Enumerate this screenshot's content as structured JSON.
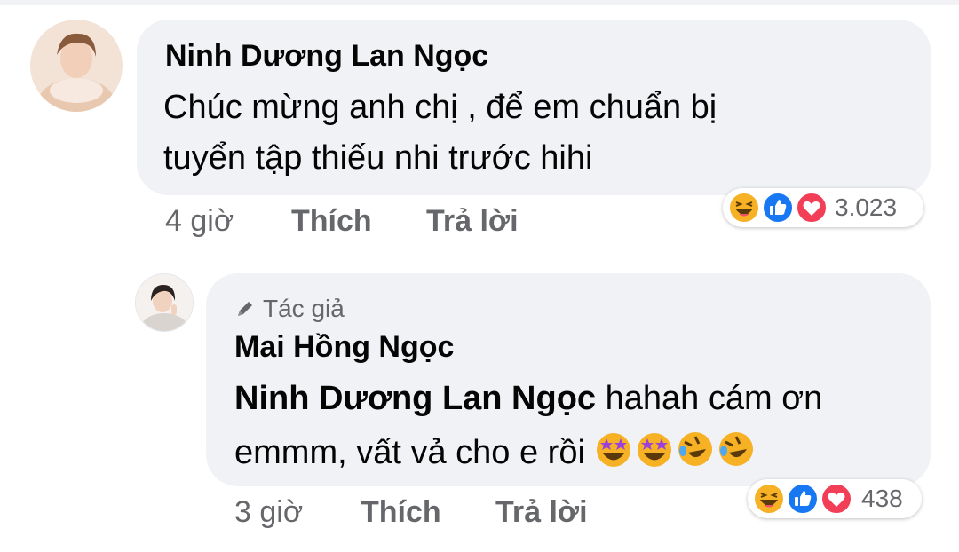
{
  "comment1": {
    "author": "Ninh Dương Lan Ngọc",
    "lines": [
      "Chúc mừng anh chị , để em chuẩn bị",
      "tuyển tập thiếu nhi trước hihi"
    ],
    "time": "4 giờ",
    "like_label": "Thích",
    "reply_label": "Trả lời",
    "reactions": {
      "icons": [
        "haha-icon",
        "like-icon",
        "love-icon"
      ],
      "count": "3.023"
    }
  },
  "reply1": {
    "badge": "Tác giả",
    "author": "Mai Hồng Ngọc",
    "mention": "Ninh Dương Lan Ngọc",
    "line1_rest": " hahah cám ơn",
    "line2": "emmm, vất vả cho e rồi",
    "inline_emojis": [
      "star-struck-emoji",
      "star-struck-emoji",
      "rofl-emoji",
      "rofl-emoji"
    ],
    "time": "3 giờ",
    "like_label": "Thích",
    "reply_label": "Trả lời",
    "reactions": {
      "icons": [
        "haha-icon",
        "like-icon",
        "love-icon"
      ],
      "count": "438"
    }
  },
  "colors": {
    "bubble": "#f0f2f5",
    "meta": "#65676b",
    "like": "#1877f2",
    "love": "#f33e58",
    "haha": "#f7b125"
  }
}
